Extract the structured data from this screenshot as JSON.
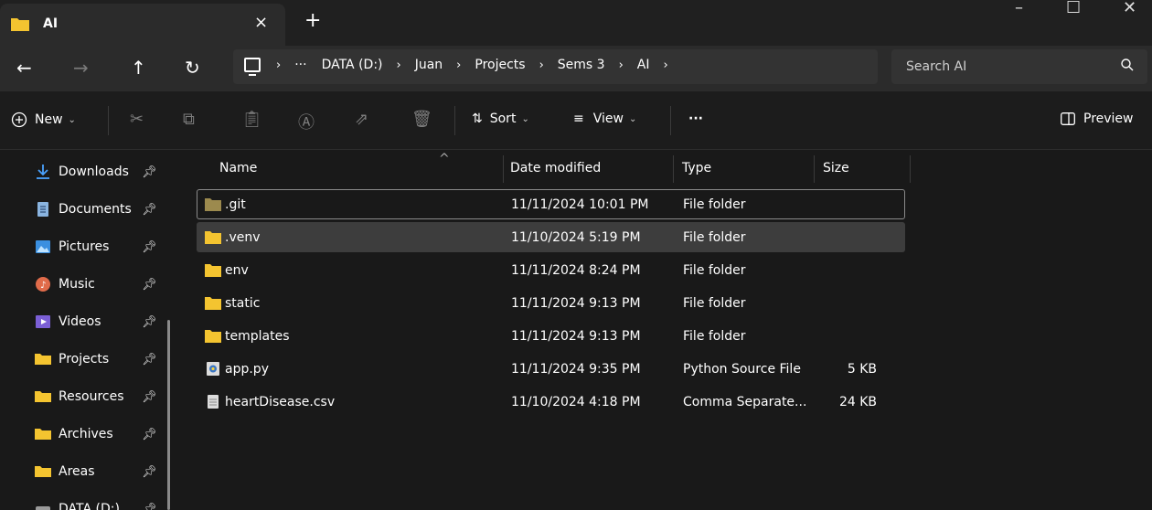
{
  "window": {
    "tab_title": "AI",
    "tab_close": "×",
    "new_tab": "+",
    "minimize": "–",
    "maximize": "☐",
    "close": "✕"
  },
  "nav": {
    "back": "←",
    "forward": "→",
    "up": "↑",
    "refresh": "↻"
  },
  "address": {
    "more": "···",
    "crumbs": [
      "DATA (D:)",
      "Juan",
      "Projects",
      "Sems 3",
      "AI"
    ],
    "separator": "›"
  },
  "search": {
    "placeholder": "Search AI"
  },
  "commands": {
    "new_label": "New",
    "sort_label": "Sort",
    "view_label": "View",
    "more_label": "···",
    "preview_label": "Preview"
  },
  "sidebar": {
    "items": [
      {
        "label": "Downloads",
        "icon": "download-icon"
      },
      {
        "label": "Documents",
        "icon": "documents-icon"
      },
      {
        "label": "Pictures",
        "icon": "pictures-icon"
      },
      {
        "label": "Music",
        "icon": "music-icon"
      },
      {
        "label": "Videos",
        "icon": "videos-icon"
      },
      {
        "label": "Projects",
        "icon": "folder-icon"
      },
      {
        "label": "Resources",
        "icon": "folder-icon"
      },
      {
        "label": "Archives",
        "icon": "folder-icon"
      },
      {
        "label": "Areas",
        "icon": "folder-icon"
      },
      {
        "label": "DATA (D:)",
        "icon": "drive-icon"
      }
    ]
  },
  "columns": {
    "name": "Name",
    "date": "Date modified",
    "type": "Type",
    "size": "Size"
  },
  "files": [
    {
      "name": ".git",
      "date": "11/11/2024 10:01 PM",
      "type": "File folder",
      "size": "",
      "kind": "folder-dim"
    },
    {
      "name": ".venv",
      "date": "11/10/2024 5:19 PM",
      "type": "File folder",
      "size": "",
      "kind": "folder"
    },
    {
      "name": "env",
      "date": "11/11/2024 8:24 PM",
      "type": "File folder",
      "size": "",
      "kind": "folder"
    },
    {
      "name": "static",
      "date": "11/11/2024 9:13 PM",
      "type": "File folder",
      "size": "",
      "kind": "folder"
    },
    {
      "name": "templates",
      "date": "11/11/2024 9:13 PM",
      "type": "File folder",
      "size": "",
      "kind": "folder"
    },
    {
      "name": "app.py",
      "date": "11/11/2024 9:35 PM",
      "type": "Python Source File",
      "size": "5 KB",
      "kind": "python"
    },
    {
      "name": "heartDisease.csv",
      "date": "11/10/2024 4:18 PM",
      "type": "Comma Separate...",
      "size": "24 KB",
      "kind": "file"
    }
  ],
  "colors": {
    "folder": "#f4c430",
    "folder_dim": "#9c8a4e",
    "accent_blue": "#4aa3ff"
  }
}
